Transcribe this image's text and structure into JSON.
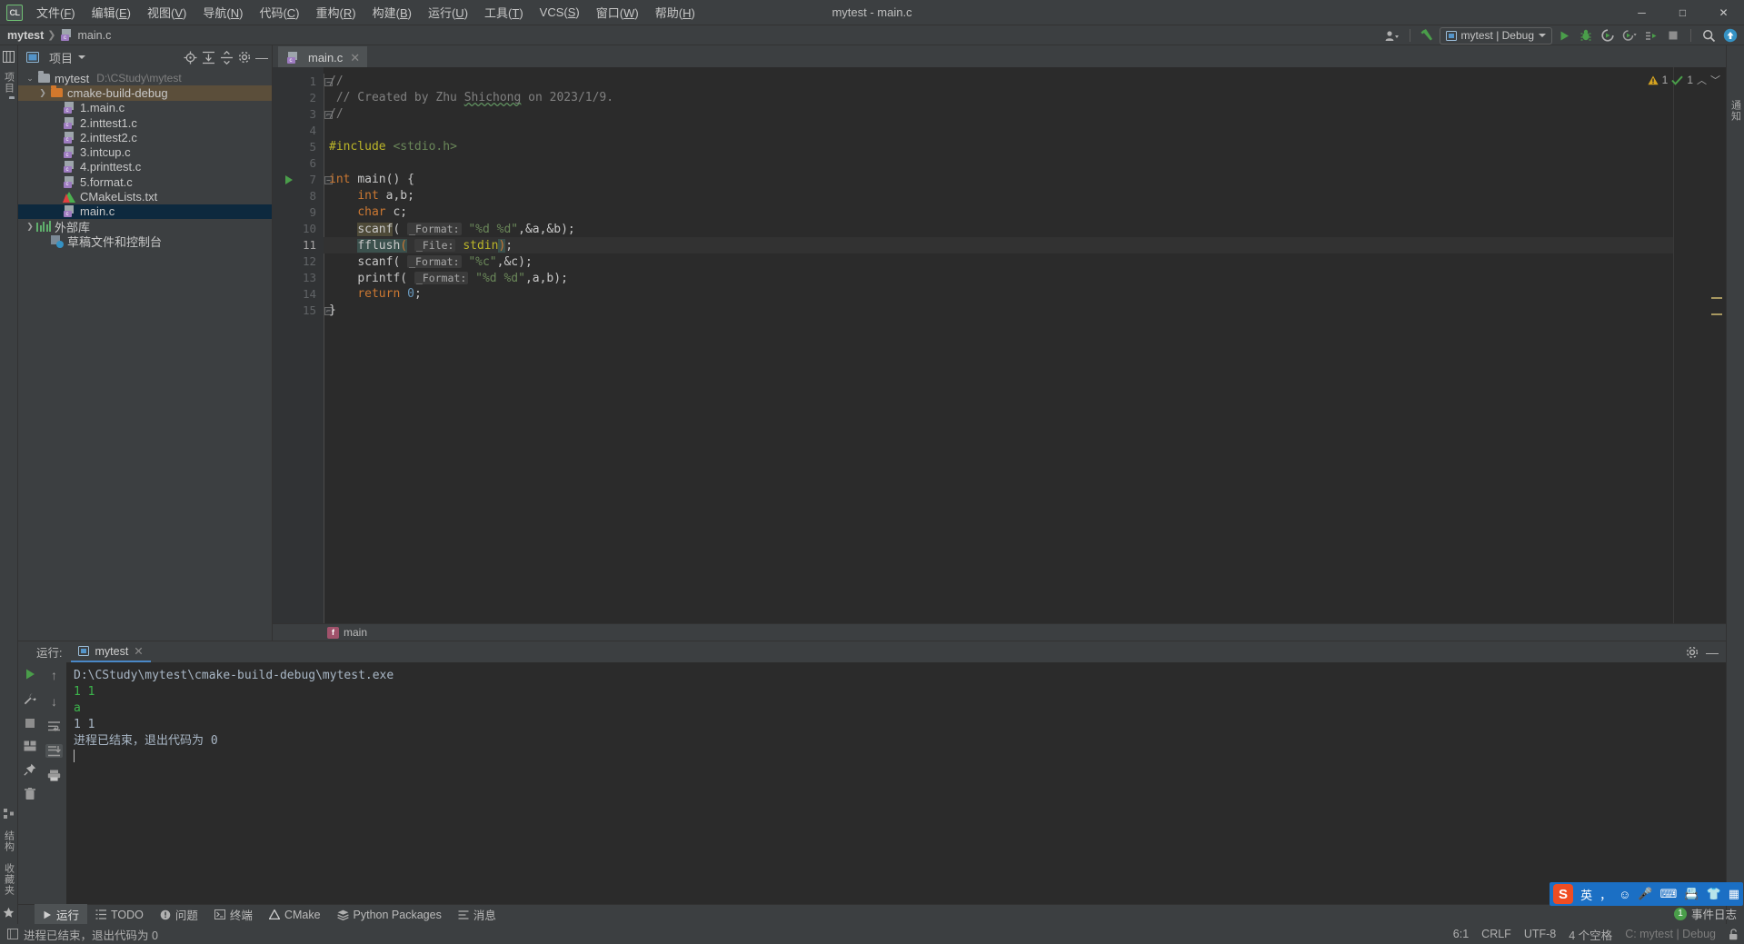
{
  "window": {
    "title": "mytest - main.c",
    "app_icon": "CL",
    "minimize": "─",
    "maximize": "□",
    "close": "✕"
  },
  "menu": [
    {
      "label": "文件",
      "mnemonic": "F"
    },
    {
      "label": "编辑",
      "mnemonic": "E"
    },
    {
      "label": "视图",
      "mnemonic": "V"
    },
    {
      "label": "导航",
      "mnemonic": "N"
    },
    {
      "label": "代码",
      "mnemonic": "C"
    },
    {
      "label": "重构",
      "mnemonic": "R"
    },
    {
      "label": "构建",
      "mnemonic": "B"
    },
    {
      "label": "运行",
      "mnemonic": "U"
    },
    {
      "label": "工具",
      "mnemonic": "T"
    },
    {
      "label": "VCS",
      "mnemonic": "S"
    },
    {
      "label": "窗口",
      "mnemonic": "W"
    },
    {
      "label": "帮助",
      "mnemonic": "H"
    }
  ],
  "navbar": {
    "crumbs": [
      "mytest",
      "main.c"
    ],
    "run_config": "mytest | Debug"
  },
  "project_panel": {
    "title": "项目",
    "tree": [
      {
        "label": "mytest",
        "path": "D:\\CStudy\\mytest",
        "icon": "folder-icon",
        "indent": 0,
        "chevron": "expanded",
        "state": "normal"
      },
      {
        "label": "cmake-build-debug",
        "path": "",
        "icon": "folder-orange-icon",
        "indent": 1,
        "chevron": "collapsed",
        "state": "selected-dir"
      },
      {
        "label": "1.main.c",
        "path": "",
        "icon": "c-file-icon",
        "indent": 2,
        "chevron": "none",
        "state": "normal"
      },
      {
        "label": "2.inttest1.c",
        "path": "",
        "icon": "c-file-icon",
        "indent": 2,
        "chevron": "none",
        "state": "normal"
      },
      {
        "label": "2.inttest2.c",
        "path": "",
        "icon": "c-file-icon",
        "indent": 2,
        "chevron": "none",
        "state": "normal"
      },
      {
        "label": "3.intcup.c",
        "path": "",
        "icon": "c-file-icon",
        "indent": 2,
        "chevron": "none",
        "state": "normal"
      },
      {
        "label": "4.printtest.c",
        "path": "",
        "icon": "c-file-icon",
        "indent": 2,
        "chevron": "none",
        "state": "normal"
      },
      {
        "label": "5.format.c",
        "path": "",
        "icon": "c-file-icon",
        "indent": 2,
        "chevron": "none",
        "state": "normal"
      },
      {
        "label": "CMakeLists.txt",
        "path": "",
        "icon": "cmake-icon",
        "indent": 2,
        "chevron": "none",
        "state": "normal"
      },
      {
        "label": "main.c",
        "path": "",
        "icon": "c-file-icon",
        "indent": 2,
        "chevron": "none",
        "state": "selected-file"
      },
      {
        "label": "外部库",
        "path": "",
        "icon": "library-icon",
        "indent": 0,
        "chevron": "collapsed",
        "state": "normal"
      },
      {
        "label": "草稿文件和控制台",
        "path": "",
        "icon": "scratch-icon",
        "indent": 1,
        "chevron": "none",
        "state": "normal"
      }
    ]
  },
  "editor": {
    "tab": {
      "label": "main.c",
      "close": "✕"
    },
    "inspection": {
      "warnings": "1",
      "infos": "1"
    },
    "breadcrumb_function": "main",
    "current_line": 11,
    "lines": [
      {
        "n": 1,
        "segments": [
          {
            "t": "//",
            "c": "cmt"
          }
        ],
        "fold": "open",
        "run": false
      },
      {
        "n": 2,
        "segments": [
          {
            "t": " // Created by Zhu ",
            "c": "cmt"
          },
          {
            "t": "Shichong",
            "c": "cmt typo"
          },
          {
            "t": " on 2023/1/9.",
            "c": "cmt"
          }
        ],
        "fold": "none",
        "run": false
      },
      {
        "n": 3,
        "segments": [
          {
            "t": "//",
            "c": "cmt"
          }
        ],
        "fold": "close",
        "run": false
      },
      {
        "n": 4,
        "segments": [],
        "fold": "none",
        "run": false
      },
      {
        "n": 5,
        "segments": [
          {
            "t": "#include ",
            "c": "mac"
          },
          {
            "t": "<stdio.h>",
            "c": "inc"
          }
        ],
        "fold": "none",
        "run": false
      },
      {
        "n": 6,
        "segments": [],
        "fold": "none",
        "run": false
      },
      {
        "n": 7,
        "segments": [
          {
            "t": "int ",
            "c": "kw"
          },
          {
            "t": "main",
            "c": "fn"
          },
          {
            "t": "() {",
            "c": "fn"
          }
        ],
        "fold": "open",
        "run": true
      },
      {
        "n": 8,
        "segments": [
          {
            "t": "    ",
            "c": "fn"
          },
          {
            "t": "int ",
            "c": "kw"
          },
          {
            "t": "a,b;",
            "c": "fn"
          }
        ],
        "fold": "none",
        "run": false
      },
      {
        "n": 9,
        "segments": [
          {
            "t": "    ",
            "c": "fn"
          },
          {
            "t": "char ",
            "c": "kw"
          },
          {
            "t": "c;",
            "c": "fn"
          }
        ],
        "fold": "none",
        "run": false
      },
      {
        "n": 10,
        "segments": [
          {
            "t": "    ",
            "c": "fn"
          },
          {
            "t": "scanf",
            "c": "fn sel-token"
          },
          {
            "t": "( ",
            "c": "fn"
          },
          {
            "t": "_Format:",
            "c": "hint"
          },
          {
            "t": " ",
            "c": "fn"
          },
          {
            "t": "\"%d %d\"",
            "c": "str"
          },
          {
            "t": ",&a,&b);",
            "c": "fn"
          }
        ],
        "fold": "none",
        "run": false
      },
      {
        "n": 11,
        "segments": [
          {
            "t": "    ",
            "c": "fn"
          },
          {
            "t": "fflush",
            "c": "fn brace-hl"
          },
          {
            "t": "(",
            "c": "kw brace-hl"
          },
          {
            "t": " ",
            "c": "fn"
          },
          {
            "t": "_File:",
            "c": "hint"
          },
          {
            "t": " ",
            "c": "fn"
          },
          {
            "t": "stdin",
            "c": "mac"
          },
          {
            "t": ")",
            "c": "kw brace-hl"
          },
          {
            "t": ";",
            "c": "fn"
          }
        ],
        "fold": "none",
        "run": false
      },
      {
        "n": 12,
        "segments": [
          {
            "t": "    ",
            "c": "fn"
          },
          {
            "t": "scanf",
            "c": "fn"
          },
          {
            "t": "( ",
            "c": "fn"
          },
          {
            "t": "_Format:",
            "c": "hint"
          },
          {
            "t": " ",
            "c": "fn"
          },
          {
            "t": "\"%c\"",
            "c": "str"
          },
          {
            "t": ",&c);",
            "c": "fn"
          }
        ],
        "fold": "none",
        "run": false
      },
      {
        "n": 13,
        "segments": [
          {
            "t": "    ",
            "c": "fn"
          },
          {
            "t": "printf",
            "c": "fn"
          },
          {
            "t": "( ",
            "c": "fn"
          },
          {
            "t": "_Format:",
            "c": "hint"
          },
          {
            "t": " ",
            "c": "fn"
          },
          {
            "t": "\"%d %d\"",
            "c": "str"
          },
          {
            "t": ",a,b);",
            "c": "fn"
          }
        ],
        "fold": "none",
        "run": false
      },
      {
        "n": 14,
        "segments": [
          {
            "t": "    ",
            "c": "fn"
          },
          {
            "t": "return ",
            "c": "kw"
          },
          {
            "t": "0",
            "c": "num"
          },
          {
            "t": ";",
            "c": "fn"
          }
        ],
        "fold": "none",
        "run": false
      },
      {
        "n": 15,
        "segments": [
          {
            "t": "}",
            "c": "fn"
          }
        ],
        "fold": "close",
        "run": false
      }
    ]
  },
  "run_window": {
    "label": "运行:",
    "tab": "mytest",
    "tab_close": "✕",
    "console_lines": [
      {
        "text": "D:\\CStudy\\mytest\\cmake-build-debug\\mytest.exe",
        "style": "normal"
      },
      {
        "text": "1 1",
        "style": "green"
      },
      {
        "text": "a",
        "style": "green"
      },
      {
        "text": "1 1",
        "style": "normal"
      },
      {
        "text": "进程已结束，退出代码为 0",
        "style": "normal"
      },
      {
        "text": "",
        "style": "caret"
      }
    ]
  },
  "bottom_tools": [
    {
      "label": "运行",
      "icon": "play-icon",
      "active": true
    },
    {
      "label": "TODO",
      "icon": "todo-icon",
      "active": false
    },
    {
      "label": "问题",
      "icon": "problems-icon",
      "active": false
    },
    {
      "label": "终端",
      "icon": "terminal-icon",
      "active": false
    },
    {
      "label": "CMake",
      "icon": "cmake-icon",
      "active": false
    },
    {
      "label": "Python Packages",
      "icon": "packages-icon",
      "active": false
    },
    {
      "label": "消息",
      "icon": "messages-icon",
      "active": false
    }
  ],
  "status_bar": {
    "message": "进程已结束，退出代码为 0",
    "caret_position": "6:1",
    "line_separator": "CRLF",
    "encoding": "UTF-8",
    "indent": "4 个空格",
    "branch": "C: mytest | Debug",
    "lock_icon": "lock-icon"
  },
  "event_log": {
    "count": "1",
    "label": "事件日志"
  },
  "left_rail": {
    "top": "项目",
    "bottom": [
      "结构",
      "收藏夹"
    ]
  },
  "right_rail": {
    "labels": [
      "通知"
    ]
  },
  "ime": {
    "logo": "S",
    "items": [
      "英",
      "，",
      "☺",
      "🎤",
      "⌨",
      "📇",
      "👕",
      "▦"
    ]
  },
  "colors": {
    "accent_blue": "#4a88c7",
    "selection_file": "#0d293e",
    "selection_dir": "#5b4e3a",
    "editor_bg": "#2b2b2b",
    "panel_bg": "#3c3f41",
    "green": "#4a9e4a",
    "warning": "#c9a227"
  }
}
